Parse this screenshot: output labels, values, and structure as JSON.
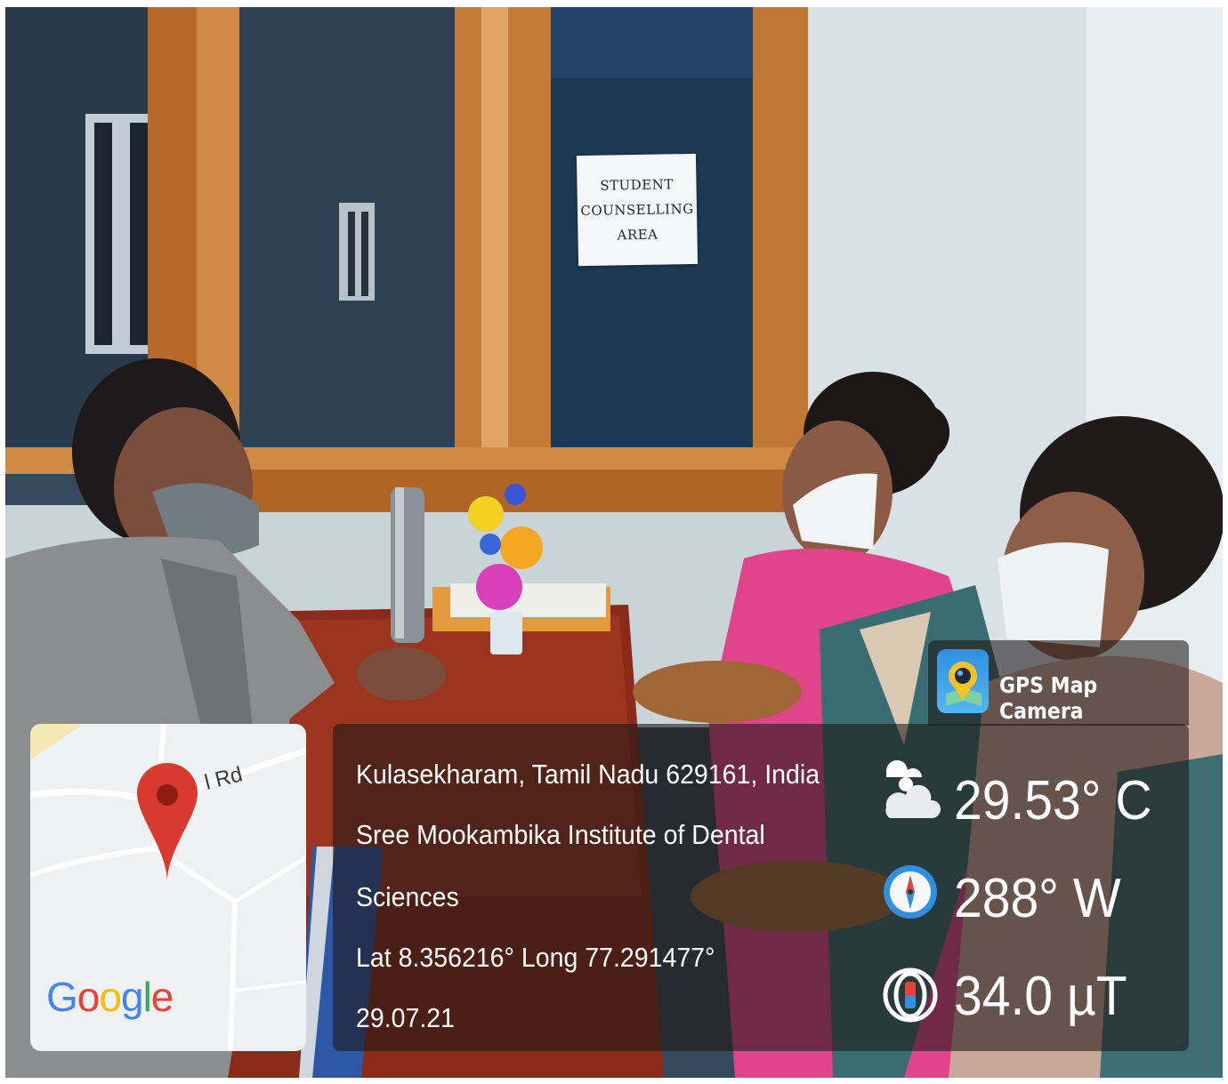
{
  "photo": {
    "sign": {
      "line1": "STUDENT",
      "line2": "COUNSELLING",
      "line3": "AREA"
    }
  },
  "overlay": {
    "app_name": "GPS Map Camera",
    "map": {
      "road_label": "l Rd",
      "logo": "Google"
    },
    "address": {
      "line1": "Kulasekharam, Tamil Nadu 629161, India",
      "line2": "Sree Mookambika Institute of Dental",
      "line3": "Sciences",
      "coordinates": "Lat 8.356216° Long 77.291477°",
      "date": "29.07.21"
    },
    "weather": {
      "temperature": "29.53° C",
      "icon": "cloud-sun-icon"
    },
    "compass": {
      "heading": "288° W",
      "icon": "compass-icon"
    },
    "magnetic": {
      "value": "34.0 µT",
      "icon": "magnet-icon"
    }
  },
  "colors": {
    "pin": "#d93a30",
    "panel": "#1e1614",
    "google_blue": "#4285f4",
    "google_red": "#ea4335",
    "google_yellow": "#fbbc05",
    "google_green": "#34a853"
  }
}
